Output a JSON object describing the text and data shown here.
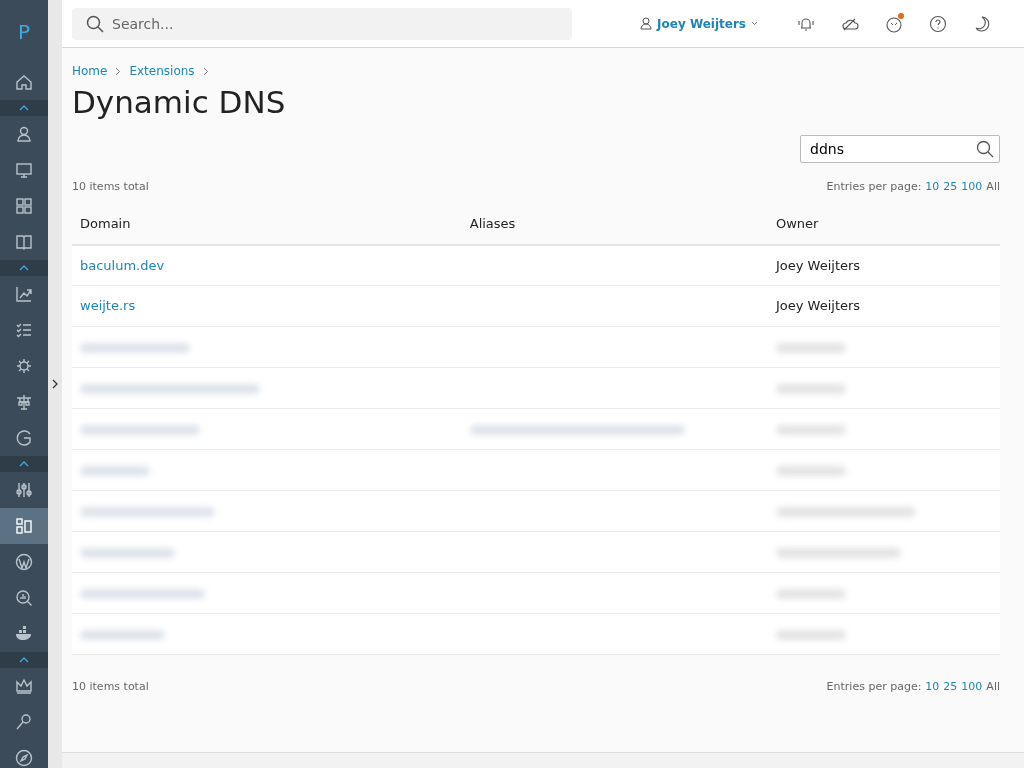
{
  "logo": "P",
  "sidebar": {
    "items": [
      {
        "kind": "item",
        "selected": false
      },
      {
        "kind": "group-toggle"
      },
      {
        "kind": "item",
        "selected": false
      },
      {
        "kind": "item",
        "selected": false
      },
      {
        "kind": "item",
        "selected": false
      },
      {
        "kind": "item",
        "selected": false
      },
      {
        "kind": "group-toggle"
      },
      {
        "kind": "item",
        "selected": false
      },
      {
        "kind": "item",
        "selected": false
      },
      {
        "kind": "item",
        "selected": false
      },
      {
        "kind": "item",
        "selected": false
      },
      {
        "kind": "item",
        "selected": false
      },
      {
        "kind": "group-toggle"
      },
      {
        "kind": "item",
        "selected": false
      },
      {
        "kind": "item",
        "selected": true
      },
      {
        "kind": "item",
        "selected": false
      },
      {
        "kind": "item",
        "selected": false
      },
      {
        "kind": "item",
        "selected": false
      },
      {
        "kind": "group-toggle"
      },
      {
        "kind": "item",
        "selected": false
      },
      {
        "kind": "item",
        "selected": false
      },
      {
        "kind": "item",
        "selected": false
      }
    ]
  },
  "topbar": {
    "search": {
      "placeholder": "Search..."
    },
    "user": "Joey Weijters",
    "notification_dot": true
  },
  "breadcrumbs": [
    "Home",
    "Extensions"
  ],
  "title": "Dynamic DNS",
  "filter": {
    "value": "ddns"
  },
  "pager_top": {
    "total": "10 items total",
    "label": "Entries per page:",
    "options": [
      {
        "label": "10",
        "selected": false
      },
      {
        "label": "25",
        "selected": false
      },
      {
        "label": "100",
        "selected": false
      },
      {
        "label": "All",
        "selected": true
      }
    ]
  },
  "table": {
    "columns": [
      "Domain",
      "Aliases",
      "Owner"
    ],
    "rows": [
      {
        "kind": "row",
        "domain": "baculum.dev",
        "owner": "Joey Weijters"
      },
      {
        "kind": "row",
        "domain": "weijte.rs",
        "owner": "Joey Weijters"
      },
      {
        "kind": "redacted",
        "aliases": false
      },
      {
        "kind": "redacted",
        "aliases": false
      },
      {
        "kind": "redacted",
        "aliases": true
      },
      {
        "kind": "redacted",
        "aliases": false
      },
      {
        "kind": "redacted",
        "aliases": false
      },
      {
        "kind": "redacted",
        "aliases": false
      },
      {
        "kind": "redacted",
        "aliases": false
      },
      {
        "kind": "redacted",
        "aliases": false
      }
    ]
  },
  "pager_bottom": {
    "total": "10 items total",
    "label": "Entries per page:",
    "options": [
      {
        "label": "10",
        "selected": false
      },
      {
        "label": "25",
        "selected": false
      },
      {
        "label": "100",
        "selected": false
      },
      {
        "label": "All",
        "selected": true
      }
    ]
  }
}
